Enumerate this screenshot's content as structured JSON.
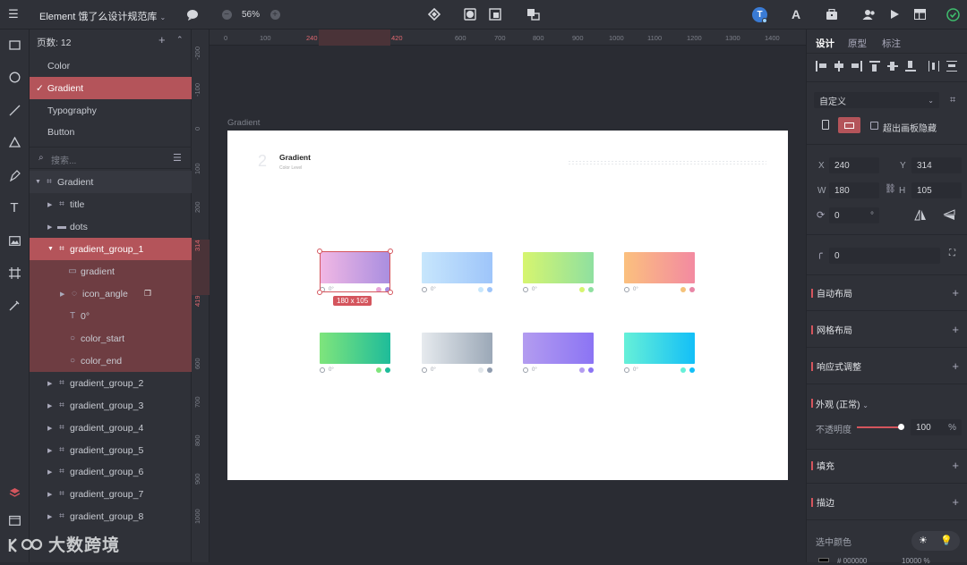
{
  "topbar": {
    "title": "Element 饿了么设计规范库",
    "zoom": "56%",
    "avatar_letter": "T",
    "avatar_color": "#3a7bd5"
  },
  "layers": {
    "page_count_label": "页数: 12",
    "pages": [
      "Color",
      "Gradient",
      "Typography",
      "Button"
    ],
    "selected_page": "Gradient",
    "search_placeholder": "搜索...",
    "tree": [
      {
        "label": "Gradient",
        "icon": "frame-icon"
      },
      {
        "label": "title",
        "icon": "frame-icon"
      },
      {
        "label": "dots",
        "icon": "folder-icon"
      },
      {
        "label": "gradient_group_1",
        "icon": "frame-icon"
      },
      {
        "label": "gradient",
        "icon": "rect-icon"
      },
      {
        "label": "icon_angle",
        "icon": "circle-dashed-icon"
      },
      {
        "label": "0°",
        "icon": "text-icon"
      },
      {
        "label": "color_start",
        "icon": "circle-icon"
      },
      {
        "label": "color_end",
        "icon": "circle-icon"
      },
      {
        "label": "gradient_group_2",
        "icon": "frame-icon"
      },
      {
        "label": "gradient_group_3",
        "icon": "frame-icon"
      },
      {
        "label": "gradient_group_4",
        "icon": "frame-icon"
      },
      {
        "label": "gradient_group_5",
        "icon": "frame-icon"
      },
      {
        "label": "gradient_group_6",
        "icon": "frame-icon"
      },
      {
        "label": "gradient_group_7",
        "icon": "frame-icon"
      },
      {
        "label": "gradient_group_8",
        "icon": "frame-icon"
      }
    ]
  },
  "canvas": {
    "ruler_top": [
      "0",
      "100",
      "240",
      "420",
      "600",
      "700",
      "800",
      "900",
      "1000",
      "1100",
      "1200",
      "1300",
      "1400"
    ],
    "ruler_left": [
      "-200",
      "-100",
      "0",
      "100",
      "200",
      "314",
      "419",
      "600",
      "700",
      "800",
      "900",
      "1000"
    ],
    "artboard_name": "Gradient",
    "artboard": {
      "number": "2",
      "title": "Gradient",
      "subtitle": "Color Level"
    },
    "swatches": [
      {
        "from": "#f2b8e4",
        "to": "#a98ee0",
        "c1": "#e9a6d8",
        "c2": "#a98ee0",
        "angle": "0°"
      },
      {
        "from": "#c7e6fc",
        "to": "#9ec5fa",
        "c1": "#c7e6fc",
        "c2": "#9ec5fa",
        "angle": "0°"
      },
      {
        "from": "#d6f56f",
        "to": "#8fe0a0",
        "c1": "#d6f56f",
        "c2": "#8fe0a0",
        "angle": "0°"
      },
      {
        "from": "#fbc07e",
        "to": "#f38aa1",
        "c1": "#f5c27a",
        "c2": "#e886a6",
        "angle": "0°"
      },
      {
        "from": "#7fe57c",
        "to": "#1ebc9a",
        "c1": "#7fe57c",
        "c2": "#1ebc9a",
        "angle": "0°"
      },
      {
        "from": "#e6eaee",
        "to": "#9ba8b7",
        "c1": "#e1e6ea",
        "c2": "#8f9caf",
        "angle": "0°"
      },
      {
        "from": "#b39cf0",
        "to": "#8b74f4",
        "c1": "#b39cf0",
        "c2": "#8b74f4",
        "angle": "0°"
      },
      {
        "from": "#66f0d8",
        "to": "#13bff7",
        "c1": "#66f0d8",
        "c2": "#13bff7",
        "angle": "0°"
      }
    ],
    "size_badge": "180 x 105"
  },
  "props": {
    "tabs": [
      "设计",
      "原型",
      "标注"
    ],
    "preset": "自定义",
    "clip_label": "超出画板隐藏",
    "x_label": "X",
    "x": "240",
    "y_label": "Y",
    "y": "314",
    "w_label": "W",
    "w": "180",
    "h_label": "H",
    "h": "105",
    "rotation": "0",
    "rotation_unit": "°",
    "radius": "0",
    "sections": [
      "自动布局",
      "网格布局",
      "响应式调整",
      "外观 (正常)",
      "填充",
      "描边"
    ],
    "opacity_label": "不透明度",
    "opacity": "100",
    "opacity_unit": "%",
    "selected_color_label": "选中颜色",
    "color_hex": "000000",
    "color_opacity": "10000",
    "color_opacity_unit": "%"
  },
  "watermark": "大数跨境",
  "accent": "#d4555d"
}
